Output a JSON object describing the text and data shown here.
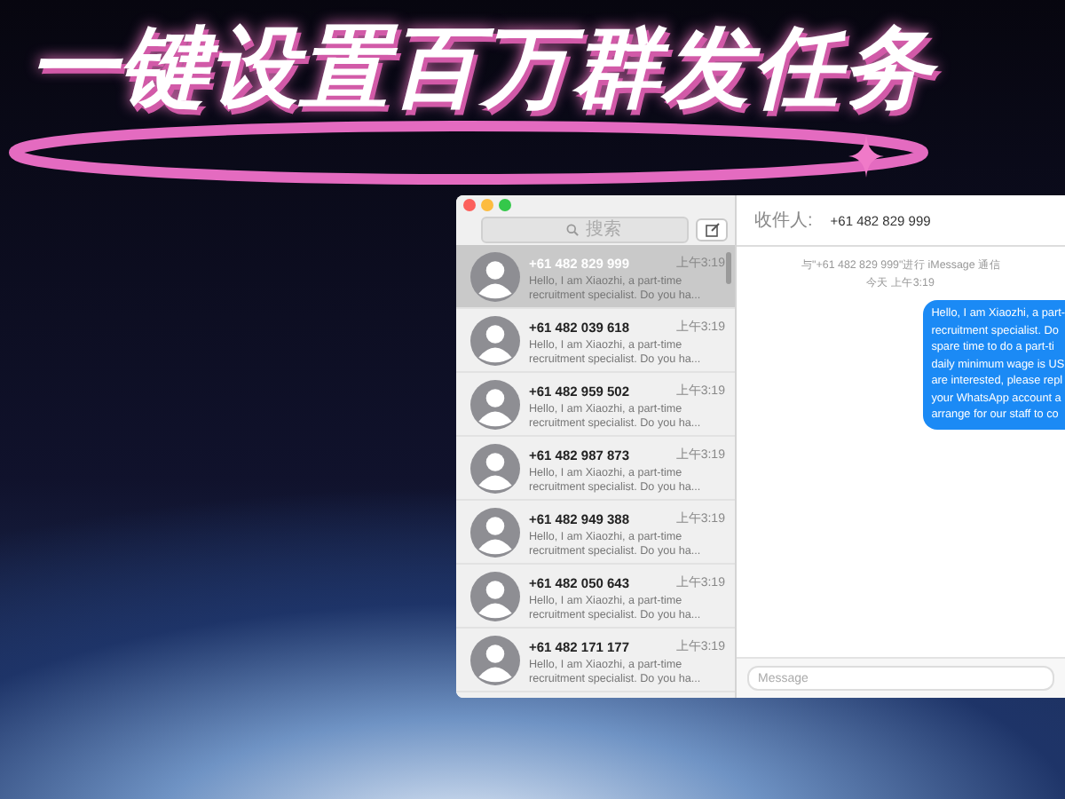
{
  "headline": "一键设置百万群发任务",
  "window": {
    "search": {
      "placeholder": "搜索"
    },
    "conversations": [
      {
        "name": "+61 482 829 999",
        "time": "上午3:19",
        "preview": "Hello, I am Xiaozhi, a part-time recruitment specialist. Do you ha...",
        "selected": true
      },
      {
        "name": "+61 482 039 618",
        "time": "上午3:19",
        "preview": "Hello, I am Xiaozhi, a part-time recruitment specialist. Do you ha...",
        "selected": false
      },
      {
        "name": "+61 482 959 502",
        "time": "上午3:19",
        "preview": "Hello, I am Xiaozhi, a part-time recruitment specialist. Do you ha...",
        "selected": false
      },
      {
        "name": "+61 482 987 873",
        "time": "上午3:19",
        "preview": "Hello, I am Xiaozhi, a part-time recruitment specialist. Do you ha...",
        "selected": false
      },
      {
        "name": "+61 482 949 388",
        "time": "上午3:19",
        "preview": "Hello, I am Xiaozhi, a part-time recruitment specialist. Do you ha...",
        "selected": false
      },
      {
        "name": "+61 482 050 643",
        "time": "上午3:19",
        "preview": "Hello, I am Xiaozhi, a part-time recruitment specialist. Do you ha...",
        "selected": false
      },
      {
        "name": "+61 482 171 177",
        "time": "上午3:19",
        "preview": "Hello, I am Xiaozhi, a part-time recruitment specialist. Do you ha...",
        "selected": false
      }
    ],
    "recipient_label": "收件人:",
    "recipient": "+61 482 829 999",
    "chat_info": "与\"+61 482 829 999\"进行 iMessage 通信",
    "chat_date": "今天 上午3:19",
    "bubble_lines": [
      "Hello, I am Xiaozhi, a part-",
      "recruitment specialist. Do",
      "spare time to do a part-ti",
      "daily minimum wage is US",
      "are interested, please repl",
      "your WhatsApp account a",
      "arrange for our staff to co"
    ],
    "message_field": {
      "placeholder": "Message"
    }
  }
}
